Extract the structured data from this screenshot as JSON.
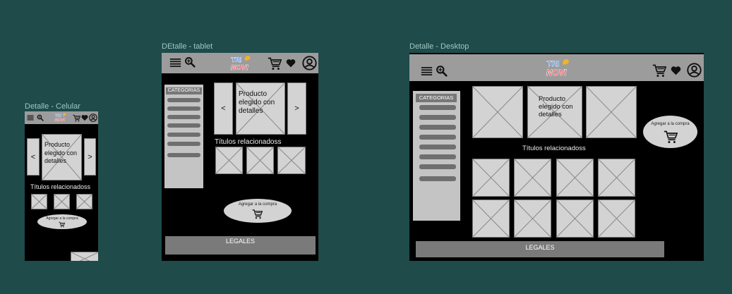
{
  "frames": {
    "mobile": {
      "label": "Detalle - Celular"
    },
    "tablet": {
      "label": "DEtalle - tablet"
    },
    "desktop": {
      "label": "Detalle - Desktop"
    }
  },
  "logo": {
    "line1": "TRI",
    "line2": "NOVI"
  },
  "product": {
    "text": "Producto elegido con detalles"
  },
  "nav": {
    "prev": "<",
    "next": ">"
  },
  "related": {
    "title": "Títulos relacionadoss"
  },
  "cart": {
    "label": "Agregar a la compra"
  },
  "sidebar": {
    "label": "CATEGORIAS"
  },
  "footer": {
    "label": "LEGALES"
  },
  "icons": {
    "menu": "menu-icon",
    "search": "search-icon",
    "cart": "cart-icon",
    "favorite": "heart-icon",
    "account": "user-icon",
    "add_to_cart": "cart-icon"
  },
  "colors": {
    "background": "#1f4b4a",
    "frame": "#000000",
    "header": "#9c9c9c",
    "placeholder": "#d3d3d3",
    "footer": "#7a7a7a"
  }
}
